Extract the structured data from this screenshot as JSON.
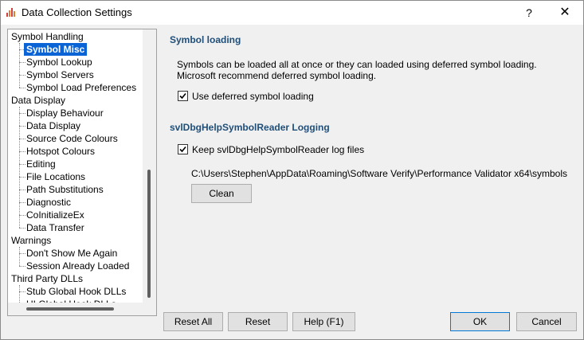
{
  "window": {
    "title": "Data Collection Settings",
    "help_glyph": "?",
    "close_glyph": "✕"
  },
  "tree": {
    "items": [
      {
        "label": "Symbol Handling"
      },
      {
        "label": "Symbol Misc"
      },
      {
        "label": "Symbol Lookup"
      },
      {
        "label": "Symbol Servers"
      },
      {
        "label": "Symbol Load Preferences"
      },
      {
        "label": "Data Display"
      },
      {
        "label": "Display Behaviour"
      },
      {
        "label": "Data Display"
      },
      {
        "label": "Source Code Colours"
      },
      {
        "label": "Hotspot Colours"
      },
      {
        "label": "Editing"
      },
      {
        "label": "File Locations"
      },
      {
        "label": "Path Substitutions"
      },
      {
        "label": "Diagnostic"
      },
      {
        "label": "CoInitializeEx"
      },
      {
        "label": "Data Transfer"
      },
      {
        "label": "Warnings"
      },
      {
        "label": "Don't Show Me Again"
      },
      {
        "label": "Session Already Loaded"
      },
      {
        "label": "Third Party DLLs"
      },
      {
        "label": "Stub Global Hook DLLs"
      },
      {
        "label": "UI Global Hook DLLs"
      }
    ],
    "selected": "Symbol Misc"
  },
  "panel": {
    "symbol_loading_title": "Symbol loading",
    "desc_line1": "Symbols can be loaded all at once or they can loaded using deferred symbol loading.",
    "desc_line2": "Microsoft recommend deferred symbol loading.",
    "deferred_label": "Use deferred symbol loading",
    "deferred_checked": true,
    "logging_title": "svlDbgHelpSymbolReader Logging",
    "keep_label": "Keep svlDbgHelpSymbolReader log files",
    "keep_checked": true,
    "path": "C:\\Users\\Stephen\\AppData\\Roaming\\Software Verify\\Performance Validator x64\\symbols",
    "clean_label": "Clean"
  },
  "buttons": {
    "reset_all": "Reset All",
    "reset": "Reset",
    "help": "Help (F1)",
    "ok": "OK",
    "cancel": "Cancel"
  }
}
